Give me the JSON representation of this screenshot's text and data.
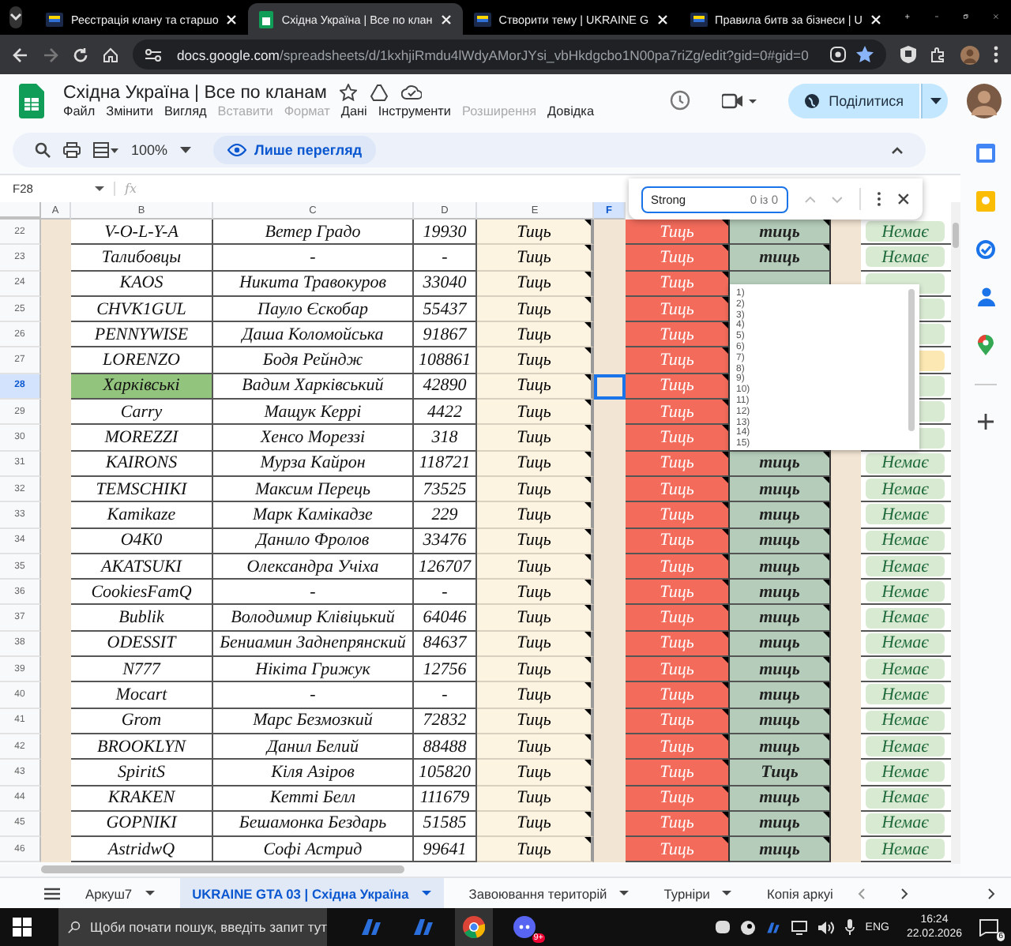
{
  "browser": {
    "tabs": [
      {
        "title": "Реєстрація клану та старшо",
        "kind": "site",
        "selected": false
      },
      {
        "title": "Східна Україна | Все по клан",
        "kind": "sheets",
        "selected": true
      },
      {
        "title": "Створити тему | UKRAINE G",
        "kind": "site",
        "selected": false
      },
      {
        "title": "Правила битв за бізнеси | U",
        "kind": "site",
        "selected": false
      }
    ],
    "url_host": "docs.google.com",
    "url_path": "/spreadsheets/d/1kxhjiRmdu4lWdyAMorJYsi_vbHkdgcbo1N00pa7riZg/edit?gid=0#gid=0"
  },
  "document": {
    "title": "Східна Україна | Все по кланам",
    "share_button": "Поділитися",
    "menu": [
      {
        "label": "Файл",
        "disabled": false
      },
      {
        "label": "Змінити",
        "disabled": false
      },
      {
        "label": "Вигляд",
        "disabled": false
      },
      {
        "label": "Вставити",
        "disabled": true
      },
      {
        "label": "Формат",
        "disabled": true
      },
      {
        "label": "Дані",
        "disabled": false
      },
      {
        "label": "Інструменти",
        "disabled": false
      },
      {
        "label": "Розширення",
        "disabled": true
      },
      {
        "label": "Довідка",
        "disabled": false
      }
    ],
    "zoom": "100%",
    "view_only": "Лише перегляд"
  },
  "formula_bar": {
    "cell_ref": "F28",
    "fx": "fx"
  },
  "columns": [
    {
      "label": "A",
      "selected": false
    },
    {
      "label": "B",
      "selected": false
    },
    {
      "label": "C",
      "selected": false
    },
    {
      "label": "D",
      "selected": false
    },
    {
      "label": "E",
      "selected": false
    },
    {
      "label": "F",
      "selected": true
    }
  ],
  "rows": [
    {
      "num": "22",
      "name": "V-O-L-Y-A",
      "leader": "Ветер Градо",
      "score": "19930",
      "e": "Тиць",
      "g": "Тиць",
      "h": "тиць",
      "j": {
        "text": "Немає",
        "color": "#d9ead3"
      },
      "selected": false,
      "name_highlighted": false
    },
    {
      "num": "23",
      "name": "Талибовцы",
      "leader": "-",
      "score": "-",
      "e": "Тиць",
      "g": "Тиць",
      "h": "тиць",
      "j": {
        "text": "Немає",
        "color": "#d9ead3"
      },
      "selected": false,
      "name_highlighted": false
    },
    {
      "num": "24",
      "name": "KAOS",
      "leader": "Никита Травокуров",
      "score": "33040",
      "e": "Тиць",
      "g": "Тиць",
      "j": {
        "color": "#d9ead3"
      },
      "selected": false,
      "name_highlighted": false
    },
    {
      "num": "25",
      "name": "CHVK1GUL",
      "leader": "Пауло Єскобар",
      "score": "55437",
      "e": "Тиць",
      "g": "Тиць",
      "j": {
        "color": "#d9ead3"
      },
      "selected": false,
      "name_highlighted": false
    },
    {
      "num": "26",
      "name": "PENNYWISE",
      "leader": "Даша Коломойська",
      "score": "91867",
      "e": "Тиць",
      "g": "Тиць",
      "j": {
        "color": "#d9ead3"
      },
      "selected": false,
      "name_highlighted": false
    },
    {
      "num": "27",
      "name": "LORENZO",
      "leader": "Бодя Рейндж",
      "score": "108861",
      "e": "Тиць",
      "g": "Тиць",
      "j": {
        "color": "#fce8b2"
      },
      "selected": false,
      "name_highlighted": false
    },
    {
      "num": "28",
      "name": "Харківські",
      "leader": "Вадим Харківський",
      "score": "42890",
      "e": "Тиць",
      "g": "Тиць",
      "j": {
        "color": "#d9ead3"
      },
      "selected": true,
      "name_highlighted": true
    },
    {
      "num": "29",
      "name": "Carry",
      "leader": "Мащук Керрі",
      "score": "4422",
      "e": "Тиць",
      "g": "Тиць",
      "j": {
        "color": "#d9ead3"
      },
      "selected": false,
      "name_highlighted": false
    },
    {
      "num": "30",
      "name": "MOREZZI",
      "leader": "Хенсо Мореззі",
      "score": "318",
      "e": "Тиць",
      "g": "Тиць",
      "j": {
        "color": "#d9ead3"
      },
      "selected": false,
      "name_highlighted": false
    },
    {
      "num": "31",
      "name": "KAIRONS",
      "leader": "Мурза Кайрон",
      "score": "118721",
      "e": "Тиць",
      "g": "Тиць",
      "h": "тиць",
      "j": {
        "text": "Немає",
        "color": "#d9ead3"
      },
      "selected": false,
      "name_highlighted": false
    },
    {
      "num": "32",
      "name": "TEMSCHIKI",
      "leader": "Максим Перець",
      "score": "73525",
      "e": "Тиць",
      "g": "Тиць",
      "h": "тиць",
      "j": {
        "text": "Немає",
        "color": "#d9ead3"
      },
      "selected": false,
      "name_highlighted": false
    },
    {
      "num": "33",
      "name": "Kamikaze",
      "leader": "Марк Камікадзе",
      "score": "229",
      "e": "Тиць",
      "g": "Тиць",
      "h": "тиць",
      "j": {
        "text": "Немає",
        "color": "#d9ead3"
      },
      "selected": false,
      "name_highlighted": false
    },
    {
      "num": "34",
      "name": "O4K0",
      "leader": "Данило Фролов",
      "score": "33476",
      "e": "Тиць",
      "g": "Тиць",
      "h": "тиць",
      "j": {
        "text": "Немає",
        "color": "#d9ead3"
      },
      "selected": false,
      "name_highlighted": false
    },
    {
      "num": "35",
      "name": "AKATSUKI",
      "leader": "Олександра Учіха",
      "score": "126707",
      "e": "Тиць",
      "g": "Тиць",
      "h": "тиць",
      "j": {
        "text": "Немає",
        "color": "#d9ead3"
      },
      "selected": false,
      "name_highlighted": false
    },
    {
      "num": "36",
      "name": "CookiesFamQ",
      "leader": "-",
      "score": "-",
      "e": "Тиць",
      "g": "Тиць",
      "h": "тиць",
      "j": {
        "text": "Немає",
        "color": "#d9ead3"
      },
      "selected": false,
      "name_highlighted": false
    },
    {
      "num": "37",
      "name": "Bublik",
      "leader": "Володимир Клівіцький",
      "score": "64046",
      "e": "Тиць",
      "g": "Тиць",
      "h": "тиць",
      "j": {
        "text": "Немає",
        "color": "#d9ead3"
      },
      "selected": false,
      "name_highlighted": false
    },
    {
      "num": "38",
      "name": "ODESSIT",
      "leader": "Бениамин Заднепрянский",
      "score": "84637",
      "e": "Тиць",
      "g": "Тиць",
      "h": "тиць",
      "j": {
        "text": "Немає",
        "color": "#d9ead3"
      },
      "selected": false,
      "name_highlighted": false
    },
    {
      "num": "39",
      "name": "N777",
      "leader": "Нікіта Грижук",
      "score": "12756",
      "e": "Тиць",
      "g": "Тиць",
      "h": "тиць",
      "j": {
        "text": "Немає",
        "color": "#d9ead3"
      },
      "selected": false,
      "name_highlighted": false
    },
    {
      "num": "40",
      "name": "Mocart",
      "leader": "-",
      "score": "-",
      "e": "Тиць",
      "g": "Тиць",
      "h": "тиць",
      "j": {
        "text": "Немає",
        "color": "#d9ead3"
      },
      "selected": false,
      "name_highlighted": false
    },
    {
      "num": "41",
      "name": "Grom",
      "leader": "Марс Безмозкий",
      "score": "72832",
      "e": "Тиць",
      "g": "Тиць",
      "h": "тиць",
      "j": {
        "text": "Немає",
        "color": "#d9ead3"
      },
      "selected": false,
      "name_highlighted": false
    },
    {
      "num": "42",
      "name": "BROOKLYN",
      "leader": "Данил Белий",
      "score": "88488",
      "e": "Тиць",
      "g": "Тиць",
      "h": "тиць",
      "j": {
        "text": "Немає",
        "color": "#d9ead3"
      },
      "selected": false,
      "name_highlighted": false
    },
    {
      "num": "43",
      "name": "SpiritS",
      "leader": "Кіля Азіров",
      "score": "105820",
      "e": "Тиць",
      "g": "Тиць",
      "h": "Тиць",
      "j": {
        "text": "Немає",
        "color": "#d9ead3"
      },
      "selected": false,
      "name_highlighted": false
    },
    {
      "num": "44",
      "name": "KRAKEN",
      "leader": "Кетті Белл",
      "score": "111679",
      "e": "Тиць",
      "g": "Тиць",
      "h": "тиць",
      "j": {
        "text": "Немає",
        "color": "#d9ead3"
      },
      "selected": false,
      "name_highlighted": false
    },
    {
      "num": "45",
      "name": "GOPNIKI",
      "leader": "Бешамонка Бездарь",
      "score": "51585",
      "e": "Тиць",
      "g": "Тиць",
      "h": "тиць",
      "j": {
        "text": "Немає",
        "color": "#d9ead3"
      },
      "selected": false,
      "name_highlighted": false
    },
    {
      "num": "46",
      "name": "AstridwQ",
      "leader": "Софі Астрид",
      "score": "99641",
      "e": "Тиць",
      "g": "Тиць",
      "h": "тиць",
      "j": {
        "text": "Немає",
        "color": "#d9ead3"
      },
      "selected": false,
      "name_highlighted": false
    }
  ],
  "find": {
    "value": "Strong",
    "count": "0 із 0"
  },
  "dropdown_list": [
    "1)",
    "2)",
    "3)",
    "4)",
    "5)",
    "6)",
    "7)",
    "8)",
    "9)",
    "10)",
    "11)",
    "12)",
    "13)",
    "14)",
    "15)"
  ],
  "sheet_tabs": [
    {
      "label": "Аркуш7",
      "selected": false
    },
    {
      "label": "UKRAINE GTA 03 | Східна Україна",
      "selected": true
    },
    {
      "label": "Завоювання територій",
      "selected": false
    },
    {
      "label": "Турніри",
      "selected": false
    },
    {
      "label": "Копія аркуі",
      "selected": false
    }
  ],
  "taskbar": {
    "search_placeholder": "Щоби почати пошук, введіть запит тут",
    "app_badge": "9+",
    "language": "ENG",
    "time": "16:24",
    "date": "22.02.2026",
    "notifications": "6"
  }
}
